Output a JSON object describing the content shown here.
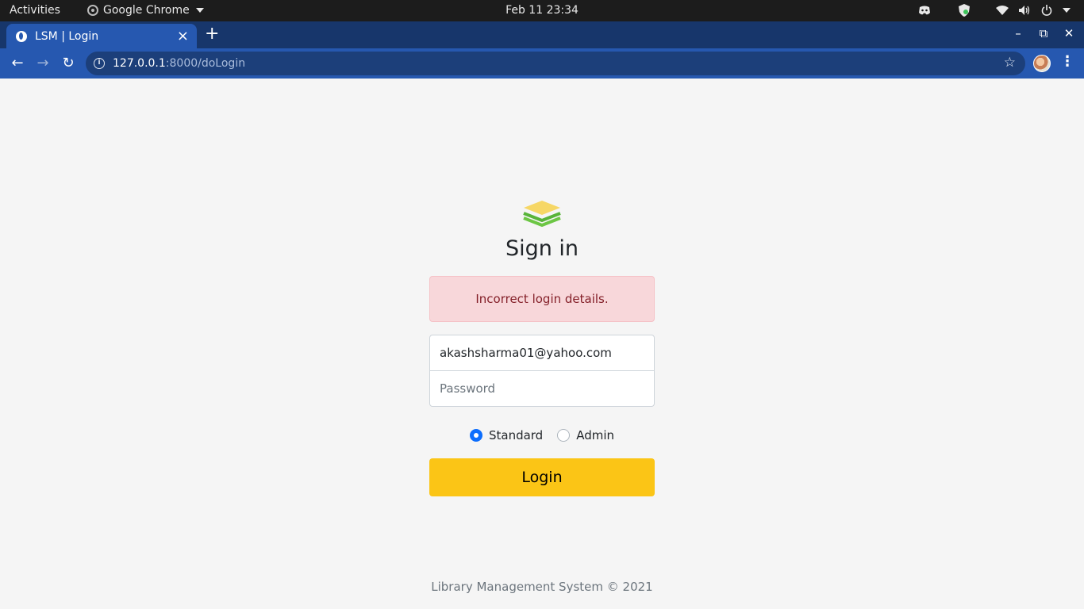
{
  "system_bar": {
    "activities": "Activities",
    "app_name": "Google Chrome",
    "clock": "Feb 11  23:34"
  },
  "browser": {
    "tab_title": "LSM | Login",
    "url_host": "127.0.0.1",
    "url_path": ":8000/doLogin",
    "accent_color": "#2658b0"
  },
  "login": {
    "heading": "Sign in",
    "alert": "Incorrect login details.",
    "email_value": "akashsharma01@yahoo.com",
    "password_placeholder": "Password",
    "radio_options": [
      "Standard",
      "Admin"
    ],
    "selected_role": "Standard",
    "button_label": "Login",
    "button_color": "#fbc516"
  },
  "footer": {
    "text": "Library Management System © 2021"
  }
}
